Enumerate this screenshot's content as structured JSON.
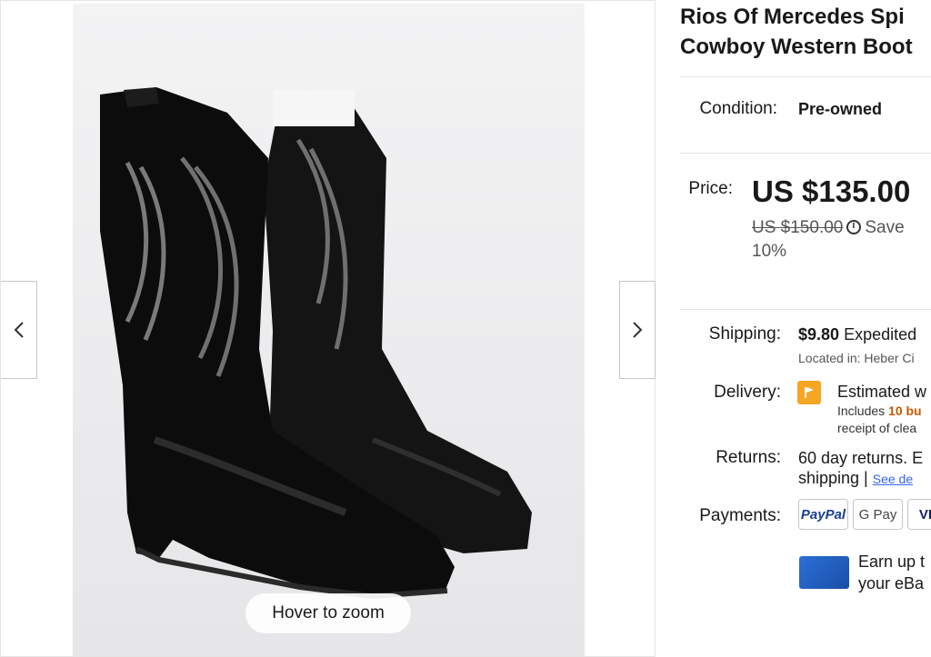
{
  "gallery": {
    "zoom_hint": "Hover to zoom",
    "prev_label": "Previous image",
    "next_label": "Next image"
  },
  "listing": {
    "title_line1": "Rios Of Mercedes Spi",
    "title_line2": "Cowboy Western Boot",
    "condition_label": "Condition:",
    "condition_value": "Pre-owned",
    "price_label": "Price:",
    "price": "US $135.00",
    "was_price": "US $150.00",
    "save_text": "Save",
    "save_pct": "10%"
  },
  "shipping": {
    "label": "Shipping:",
    "cost": "$9.80",
    "method": "Expedited",
    "location_label": "Located in:",
    "location_value": "Heber Ci"
  },
  "delivery": {
    "label": "Delivery:",
    "estimate": "Estimated w",
    "includes_prefix": "Includes",
    "includes_highlight": "10 bu",
    "receipt": "receipt of clea"
  },
  "returns": {
    "label": "Returns:",
    "line1": "60 day returns. E",
    "line2_prefix": "shipping |",
    "line2_link": "See de"
  },
  "payments": {
    "label": "Payments:",
    "methods": [
      "PayPal",
      "G Pay",
      "VI"
    ]
  },
  "promo": {
    "line1": "Earn up t",
    "line2": "your eBa"
  },
  "colors": {
    "accent": "#3665f3",
    "orange": "#c55a00",
    "flag": "#f5a623"
  }
}
